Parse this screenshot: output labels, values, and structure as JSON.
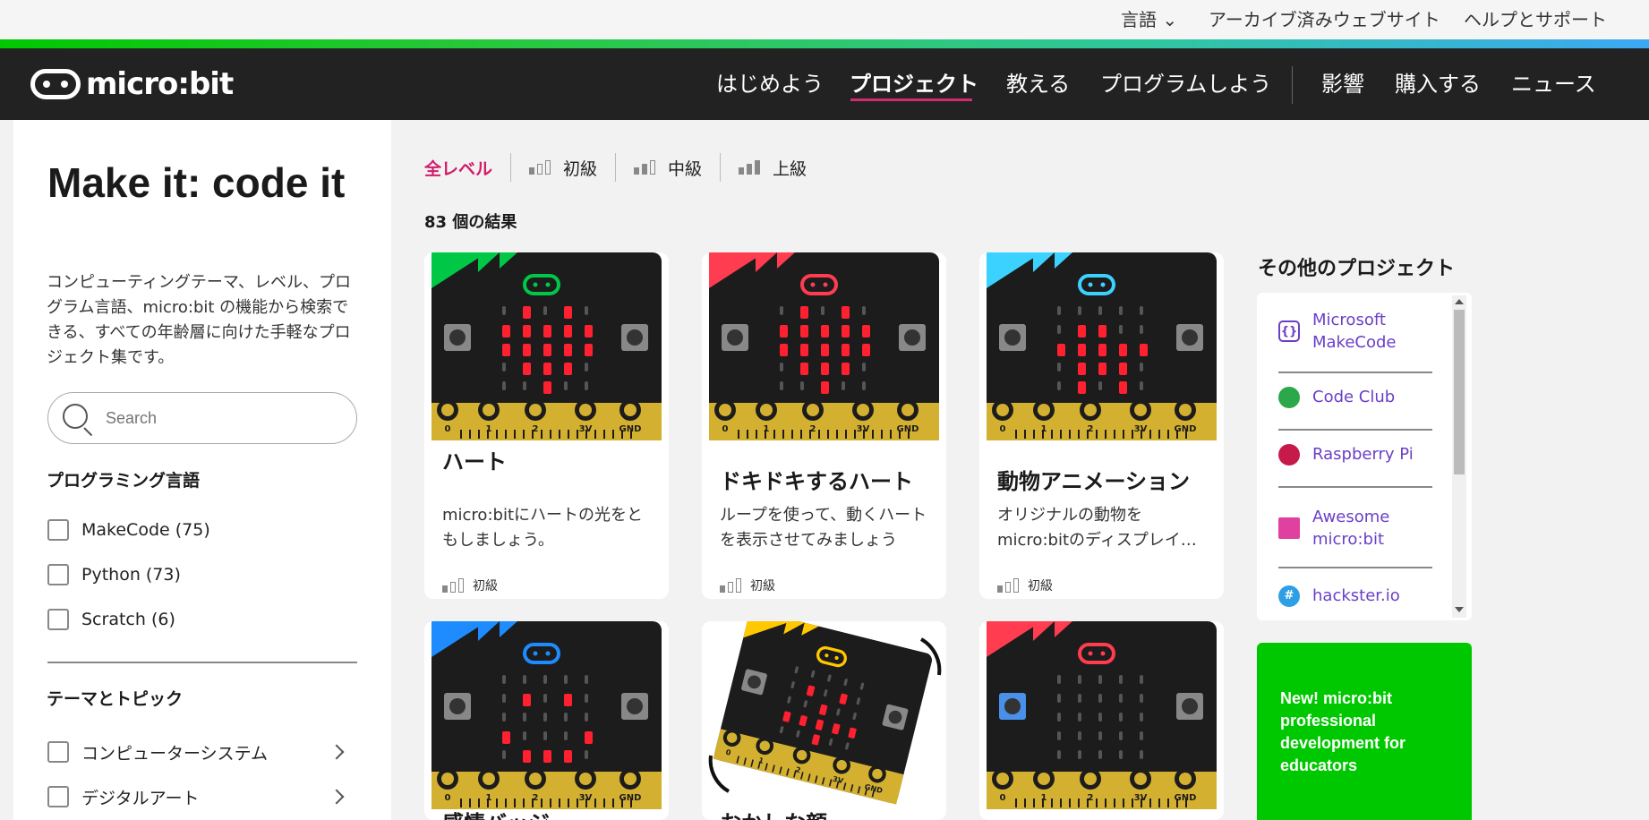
{
  "utility": {
    "language": "言語",
    "archived": "アーカイブ済みウェブサイト",
    "help": "ヘルプとサポート"
  },
  "nav": {
    "logo": "micro:bit",
    "items": [
      "はじめよう",
      "プロジェクト",
      "教える",
      "プログラムしよう",
      "影響",
      "購入する",
      "ニュース"
    ],
    "active": "プロジェクト"
  },
  "sidebar": {
    "title": "Make it: code it",
    "description": "コンピューティングテーマ、レベル、プログラム言語、micro:bit の機能から検索できる、すべての年齢層に向けた手軽なプロジェクト集です。",
    "search_placeholder": "Search",
    "languages_heading": "プログラミング言語",
    "languages": [
      "MakeCode (75)",
      "Python (73)",
      "Scratch (6)"
    ],
    "topics_heading": "テーマとトピック",
    "topics": [
      "コンピューターシステム",
      "デジタルアート"
    ]
  },
  "levels": {
    "all": "全レベル",
    "beginner": "初級",
    "intermediate": "中級",
    "advanced": "上級"
  },
  "results": "83 個の結果",
  "cards": [
    {
      "title": "ハート",
      "desc": "micro:bitにハートの光をともしましょう。",
      "level": "初級",
      "accent": "#00c846"
    },
    {
      "title": "ドキドキするハート",
      "desc": "ループを使って、動くハートを表示させてみましょう",
      "level": "初級",
      "accent": "#ff3c50"
    },
    {
      "title": "動物アニメーション",
      "desc": "オリジナルの動物をmicro:bitのディスプレイ…",
      "level": "初級",
      "accent": "#3cd2ff"
    },
    {
      "title": "感情バッジ",
      "accent": "#1e8cff"
    },
    {
      "title": "おかしな顔",
      "accent": "#ffc800"
    },
    {
      "title": "",
      "accent": "#ff3c50"
    }
  ],
  "other": {
    "title": "その他のプロジェクト",
    "items": [
      "Microsoft MakeCode",
      "Code Club",
      "Raspberry Pi",
      "Awesome micro:bit",
      "hackster.io"
    ]
  },
  "promo": {
    "text": "New! micro:bit professional development for educators"
  },
  "colors": {
    "accent": "#d21c6a",
    "link": "#6a3fc8",
    "promo": "#00c800",
    "nav_bg": "#222222"
  }
}
